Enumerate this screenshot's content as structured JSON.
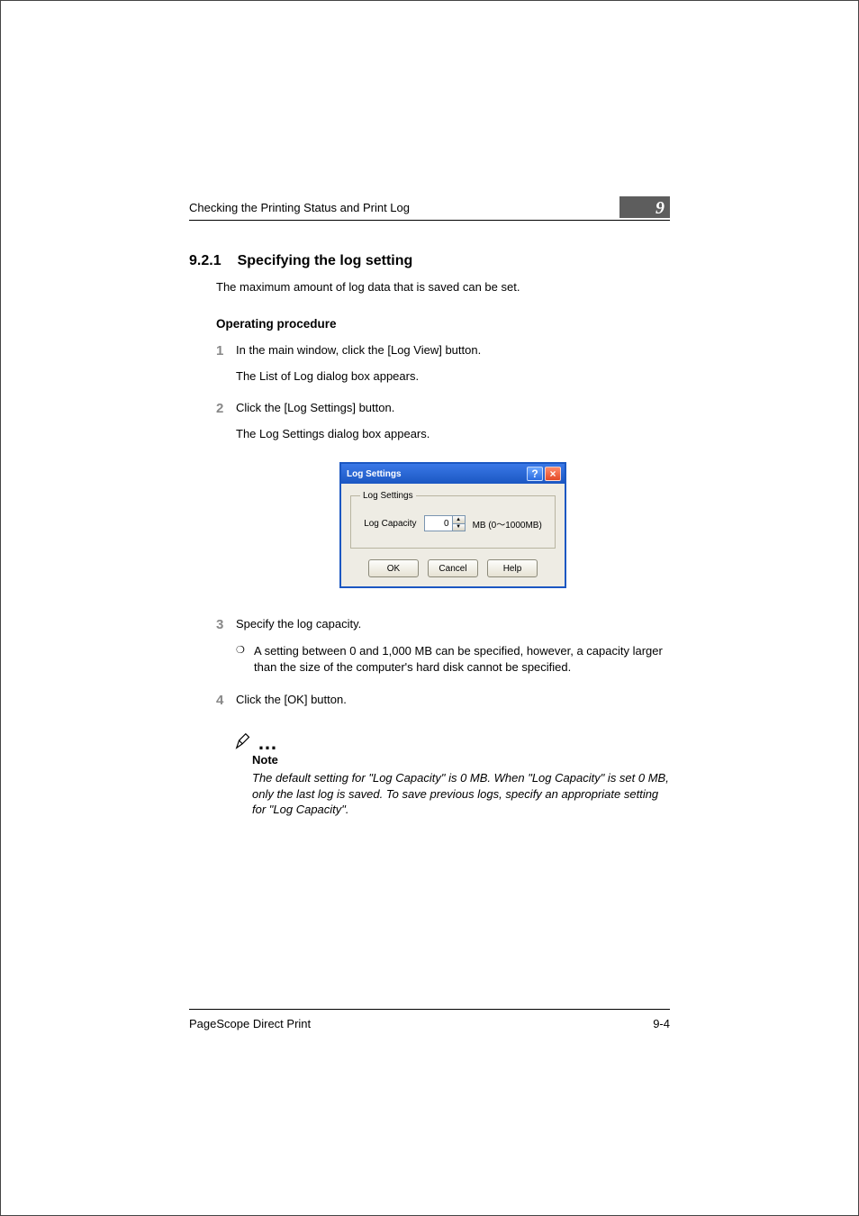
{
  "header": {
    "running_title": "Checking the Printing Status and Print Log",
    "chapter_number": "9"
  },
  "section": {
    "number": "9.2.1",
    "title": "Specifying the log setting",
    "intro": "The maximum amount of log data that is saved can be set."
  },
  "subheading": "Operating procedure",
  "steps": {
    "s1": {
      "text": "In the main window, click the [Log View] button.",
      "sub": "The List of Log dialog box appears."
    },
    "s2": {
      "text": "Click the [Log Settings] button.",
      "sub": "The Log Settings dialog box appears."
    },
    "s3": {
      "text": "Specify the log capacity.",
      "bullet": "A setting between 0 and 1,000 MB can be specified, however, a capacity larger than the size of the computer's hard disk cannot be specified."
    },
    "s4": {
      "text": "Click the [OK] button."
    }
  },
  "dialog": {
    "title": "Log Settings",
    "help_symbol": "?",
    "close_symbol": "×",
    "group_label": "Log Settings",
    "capacity_label": "Log Capacity",
    "capacity_value": "0",
    "capacity_unit": "MB (0～1000MB)",
    "buttons": {
      "ok": "OK",
      "cancel": "Cancel",
      "help": "Help"
    }
  },
  "note": {
    "label": "Note",
    "text": "The default setting for \"Log Capacity\" is 0 MB. When \"Log Capacity\" is set 0 MB, only the last log is saved. To save previous logs, specify an appropriate setting for \"Log Capacity\"."
  },
  "footer": {
    "product": "PageScope Direct Print",
    "page": "9-4"
  }
}
